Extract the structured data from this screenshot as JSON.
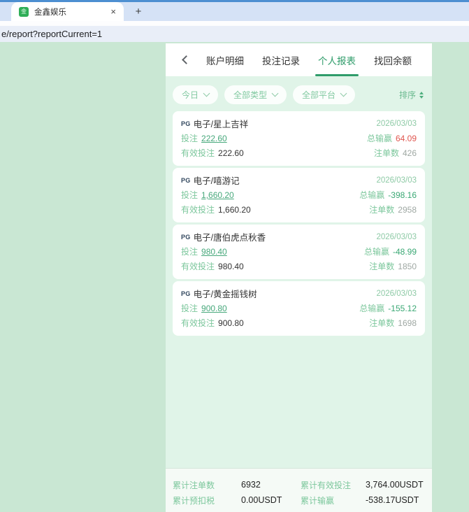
{
  "browser": {
    "tab_title": "金鑫娱乐",
    "favicon_glyph": "金",
    "close_label": "×",
    "new_tab_label": "+",
    "url": "e/report?reportCurrent=1"
  },
  "nav": {
    "tabs": [
      {
        "label": "账户明细"
      },
      {
        "label": "投注记录"
      },
      {
        "label": "个人报表"
      },
      {
        "label": "找回余额"
      }
    ]
  },
  "filters": {
    "date": "今日",
    "type": "全部类型",
    "platform": "全部平台",
    "sort_label": "排序"
  },
  "labels": {
    "bet": "投注",
    "valid_bet": "有效投注",
    "win": "总输赢",
    "count": "注单数"
  },
  "cards": [
    {
      "provider": "PG",
      "title": "电子/星上吉祥",
      "date": "2026/03/03",
      "bet": "222.60",
      "win": "64.09",
      "valid_bet": "222.60",
      "count": "426"
    },
    {
      "provider": "PG",
      "title": "电子/嘻游记",
      "date": "2026/03/03",
      "bet": "1,660.20",
      "win": "-398.16",
      "valid_bet": "1,660.20",
      "count": "2958"
    },
    {
      "provider": "PG",
      "title": "电子/唐伯虎点秋香",
      "date": "2026/03/03",
      "bet": "980.40",
      "win": "-48.99",
      "valid_bet": "980.40",
      "count": "1850"
    },
    {
      "provider": "PG",
      "title": "电子/黄金摇钱树",
      "date": "2026/03/03",
      "bet": "900.80",
      "win": "-155.12",
      "valid_bet": "900.80",
      "count": "1698"
    }
  ],
  "summary": {
    "count_label": "累计注单数",
    "count_value": "6932",
    "valid_label": "累计有效投注",
    "valid_value": "3,764.00USDT",
    "tax_label": "累计预扣税",
    "tax_value": "0.00USDT",
    "win_label": "累计输赢",
    "win_value": "-538.17USDT"
  },
  "colors": {
    "accent_green": "#2f9c6a",
    "label_green": "#7cc79c",
    "positive_red": "#e0564f",
    "negative_green": "#3aa874",
    "page_bg": "#c9e7d3",
    "panel_bg": "#e0f4e8"
  }
}
